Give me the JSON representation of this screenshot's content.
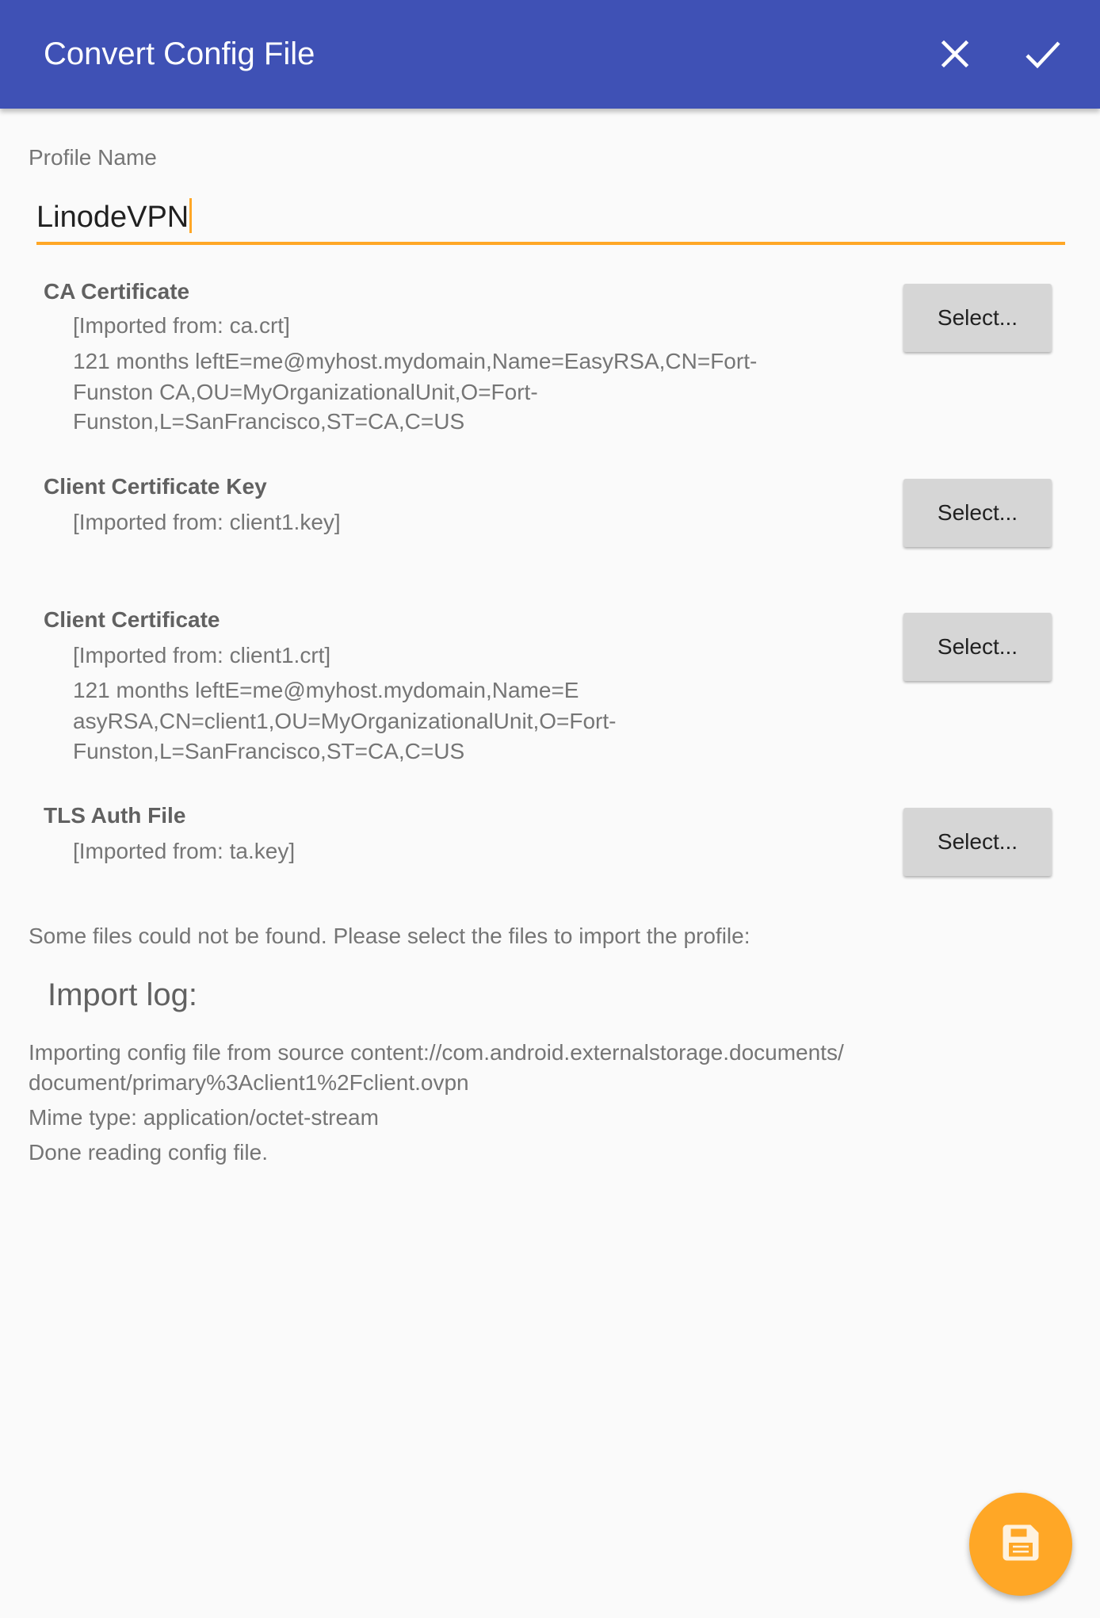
{
  "toolbar": {
    "title": "Convert Config File",
    "close_icon": "close-icon",
    "confirm_icon": "check-icon",
    "color": "#3f51b5"
  },
  "profile": {
    "label": "Profile Name",
    "value": "LinodeVPN"
  },
  "sections": [
    {
      "heading": "CA Certificate",
      "lines": [
        "[Imported from: ca.crt]",
        "121 months leftE=me@myhost.mydomain,Name=EasyRSA,CN=Fort-",
        "Funston CA,OU=MyOrganizationalUnit,O=Fort-",
        "Funston,L=SanFrancisco,ST=CA,C=US"
      ],
      "button": "Select..."
    },
    {
      "heading": "Client Certificate Key",
      "lines": [
        "[Imported from: client1.key]"
      ],
      "button": "Select..."
    },
    {
      "heading": "Client Certificate",
      "lines": [
        "[Imported from: client1.crt]",
        "121 months leftE=me@myhost.mydomain,Name=E",
        "asyRSA,CN=client1,OU=MyOrganizationalUnit,O=Fort-",
        "Funston,L=SanFrancisco,ST=CA,C=US"
      ],
      "button": "Select..."
    },
    {
      "heading": "TLS Auth File",
      "lines": [
        "[Imported from: ta.key]"
      ],
      "button": "Select..."
    }
  ],
  "message": "Some files could not be found. Please select the files to import the profile:",
  "log": {
    "title": "Import log:",
    "lines": [
      "Importing config file from source content://com.android.externalstorage.documents/",
      "document/primary%3Aclient1%2Fclient.ovpn",
      "Mime type: application/octet-stream",
      "Done reading config file."
    ]
  },
  "fab": {
    "icon": "save-icon",
    "color": "#ffa726"
  }
}
